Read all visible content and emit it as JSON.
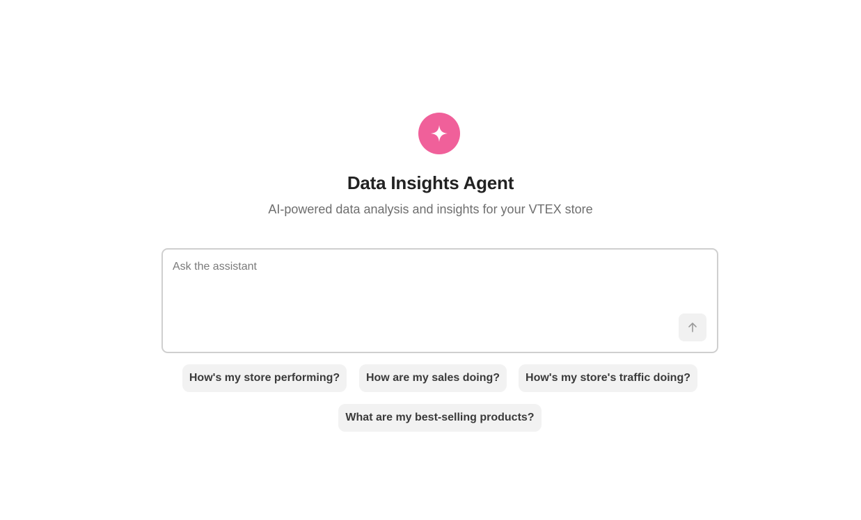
{
  "header": {
    "logo_icon": "sparkle-icon",
    "logo_color": "#f0609a",
    "title": "Data Insights Agent",
    "subtitle": "AI-powered data analysis and insights for your VTEX store"
  },
  "composer": {
    "placeholder": "Ask the assistant",
    "value": "",
    "send_icon": "arrow-up-icon"
  },
  "suggestions": [
    {
      "label": "How's my store performing?"
    },
    {
      "label": "How are my sales doing?"
    },
    {
      "label": "How's my store's traffic doing?"
    },
    {
      "label": "What are my best-selling products?"
    }
  ]
}
